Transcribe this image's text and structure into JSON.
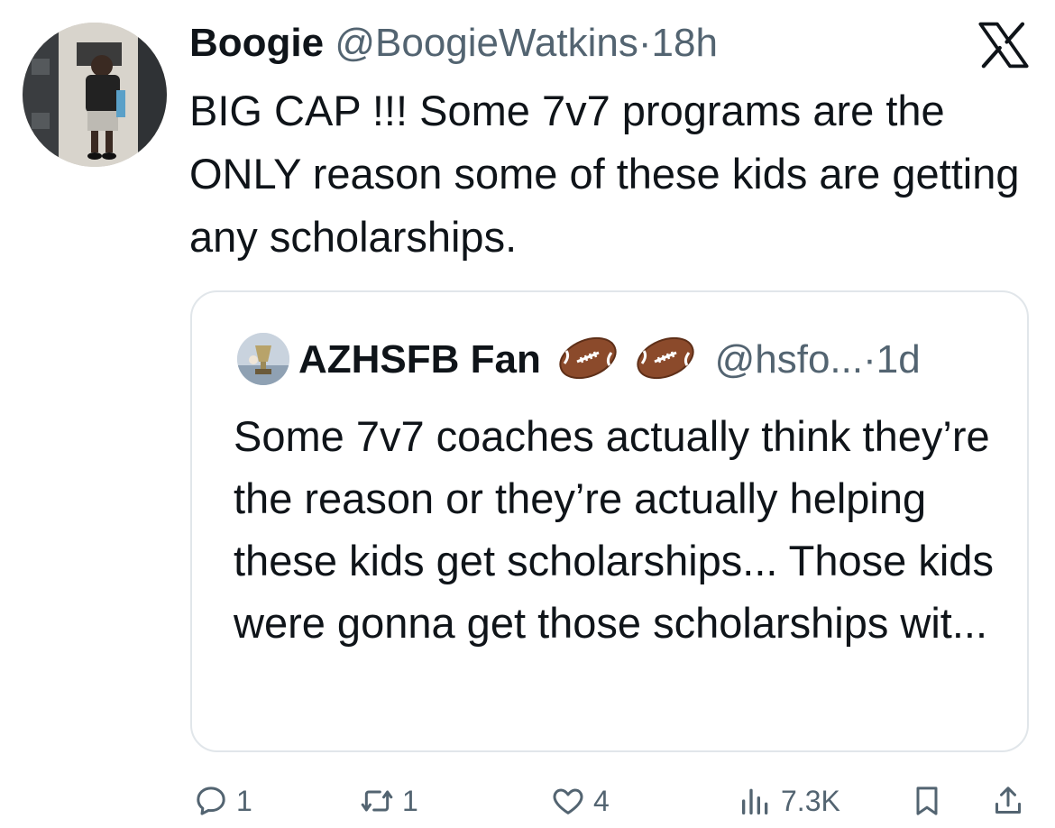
{
  "tweet": {
    "author_name": "Boogie",
    "handle": "@BoogieWatkins",
    "separator": "·",
    "time": "18h",
    "text": "BIG CAP !!! Some 7v7 programs are the ONLY reason some of these kids are getting any scholarships."
  },
  "quoted": {
    "author_name": "AZHSFB Fan",
    "emoji_icons": [
      "football-icon",
      "football-icon"
    ],
    "handle": "@hsfo...",
    "separator": "·",
    "time": "1d",
    "text": "Some 7v7 coaches actually think they’re the reason or they’re actually helping these kids get scholarships... Those kids were gonna get those scholarships wit..."
  },
  "actions": {
    "replies": "1",
    "reposts": "1",
    "likes": "4",
    "views": "7.3K"
  },
  "colors": {
    "text": "#0f1419",
    "muted": "#536471",
    "border": "#e1e6ea"
  }
}
